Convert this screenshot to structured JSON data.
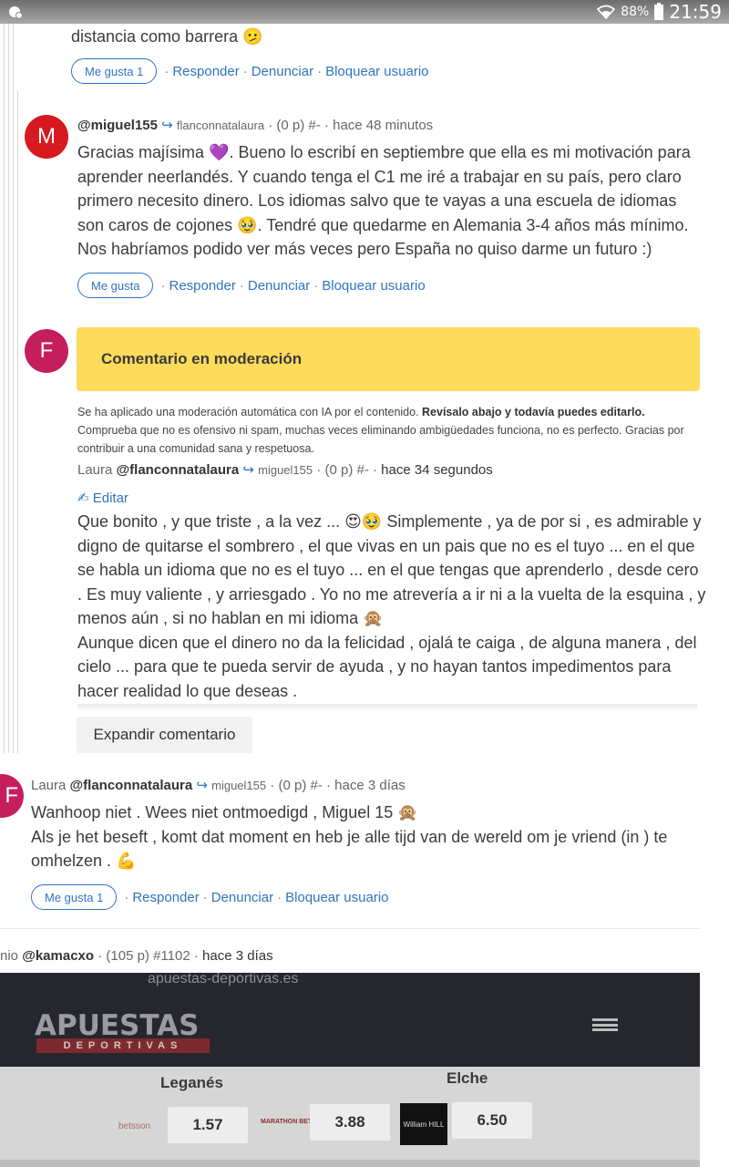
{
  "status_bar": {
    "battery": "88%",
    "time": "21:59"
  },
  "comment_prev": {
    "text_tail": "distancia como barrera 🫤",
    "actions": {
      "like": "Me gusta 1",
      "reply": "Responder",
      "report": "Denunciar",
      "block": "Bloquear usuario"
    }
  },
  "comment_miguel": {
    "avatar_letter": "M",
    "author": "@miguel155",
    "reply_to": "flanconnatalaura",
    "points": "(0 p)",
    "number": "#-",
    "time": "hace 48 minutos",
    "text": "Gracias majísima  💜. Bueno lo escribí en septiembre que ella es mi motivación para aprender neerlandés. Y cuando tenga el C1 me iré a trabajar en su país, pero claro primero necesito dinero. Los idiomas salvo que te vayas a una escuela de idiomas son caros de cojones 🥹. Tendré que quedarme en Alemania 3-4 años más mínimo. Nos habríamos podido ver más veces pero España no quiso darme un futuro :)",
    "actions": {
      "like": "Me gusta",
      "reply": "Responder",
      "report": "Denunciar",
      "block": "Bloquear usuario"
    }
  },
  "comment_moderation": {
    "avatar_letter": "F",
    "banner": "Comentario en moderación",
    "note_plain": "Se ha aplicado una moderación automática con IA por el contenido. ",
    "note_bold": "Revísalo abajo y todavía puedes editarlo.",
    "note_rest": "Comprueba que no es ofensivo ni spam, muchas veces eliminando ambigüedades funciona, no es perfecto. Gracias por contribuir a una comunidad sana y respetuosa.",
    "author_name": "Laura",
    "author": "@flanconnatalaura",
    "reply_to": "miguel155",
    "points": "(0 p)",
    "number": "#-",
    "time": "hace 34 segundos",
    "edit": "✍ Editar",
    "text_p1": "Que bonito , y que triste , a la vez ... 😍🥹 Simplemente , ya de por si , es admirable y digno de quitarse el sombrero , el que vivas en un pais que no es el tuyo ... en el que se habla un idioma que no es el tuyo ... en el que tengas que aprenderlo , desde cero . Es muy valiente , y arriesgado . Yo no me atrevería a ir ni a la vuelta de la esquina , y menos aún , si no hablan en mi idioma 🙊",
    "text_p2": "Aunque dicen que el dinero no da la felicidad , ojalá te caiga , de alguna manera , del cielo ... para que te pueda servir de ayuda , y no hayan tantos impedimentos para hacer realidad lo que deseas .",
    "expand": "Expandir comentario"
  },
  "comment_laura": {
    "avatar_letter": "F",
    "author_name": "Laura",
    "author": "@flanconnatalaura",
    "reply_to": "miguel155",
    "points": "(0 p)",
    "number": "#-",
    "time": "hace 3 días",
    "text_p1": "Wanhoop niet . Wees niet ontmoedigd , Miguel 15 🙊",
    "text_p2": "Als je het beseft , komt dat moment en heb je alle tijd van de wereld om je vriend (in ) te omhelzen . 💪",
    "actions": {
      "like": "Me gusta 1",
      "reply": "Responder",
      "report": "Denunciar",
      "block": "Bloquear usuario"
    }
  },
  "comment_kamacxo": {
    "author_prefix": "nio",
    "author": "@kamacxo",
    "points": "(105 p)",
    "number": "#1102",
    "time": "hace 3 días",
    "photo": {
      "url": "apuestas-deportivas.es",
      "brand": "APUESTAS",
      "brand_sub": "DEPORTIVAS",
      "team_home": "Leganés",
      "team_away": "Elche",
      "book1": "betsson",
      "odd1": "1.57",
      "book2": "MARATHON BET",
      "odd2": "3.88",
      "book3": "William HILL",
      "odd3": "6.50"
    }
  },
  "colors": {
    "link": "#2f74c0",
    "moderation": "#fddb5b",
    "avatar_m": "#d71920",
    "avatar_f": "#c41e5c"
  }
}
